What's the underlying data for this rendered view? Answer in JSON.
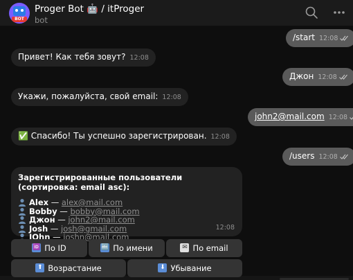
{
  "header": {
    "title": "Proger Bot 🤖 / itProger",
    "subtitle": "bot",
    "avatar_tag": "BOT"
  },
  "messages": [
    {
      "dir": "out",
      "text": "/start",
      "time": "12:08"
    },
    {
      "dir": "in",
      "text": "Привет! Как тебя зовут?",
      "time": "12:08"
    },
    {
      "dir": "out",
      "text": "Джон",
      "time": "12:08"
    },
    {
      "dir": "in",
      "text": "Укажи, пожалуйста, свой email:",
      "time": "12:08"
    },
    {
      "dir": "out",
      "text": "john2@mail.com",
      "time": "12:08"
    },
    {
      "dir": "in",
      "text": "✅ Спасибо! Ты успешно зарегистрирован.",
      "time": "12:08"
    },
    {
      "dir": "out",
      "text": "/users",
      "time": "12:08"
    }
  ],
  "users_list": {
    "heading": "Зарегистрированные пользователи (сортировка: email asc):",
    "time": "12:08",
    "users": [
      {
        "name": "Alex",
        "email": "alex@mail.com"
      },
      {
        "name": "Bobby",
        "email": "bobby@mail.com"
      },
      {
        "name": "Джон",
        "email": "john2@mail.com"
      },
      {
        "name": "Josh",
        "email": "josh@gmail.com"
      },
      {
        "name": "JOhn",
        "email": "joshn@mail.com"
      }
    ],
    "separator": " — "
  },
  "keyboard": {
    "row1": [
      {
        "icon": "id-emoji-icon",
        "label": "По ID"
      },
      {
        "icon": "abc-emoji-icon",
        "label": "По имени"
      },
      {
        "icon": "email-emoji-icon",
        "label": "По email"
      }
    ],
    "row2": [
      {
        "icon": "up-arrow-emoji-icon",
        "label": "Возрастание"
      },
      {
        "icon": "down-arrow-emoji-icon",
        "label": "Убывание"
      }
    ]
  },
  "colors": {
    "background": "#0e0e0e",
    "header": "#1b1b1b",
    "incoming_bubble": "#222222",
    "outgoing_bubble": "#5a5a5a",
    "keyboard_button": "#343434"
  }
}
